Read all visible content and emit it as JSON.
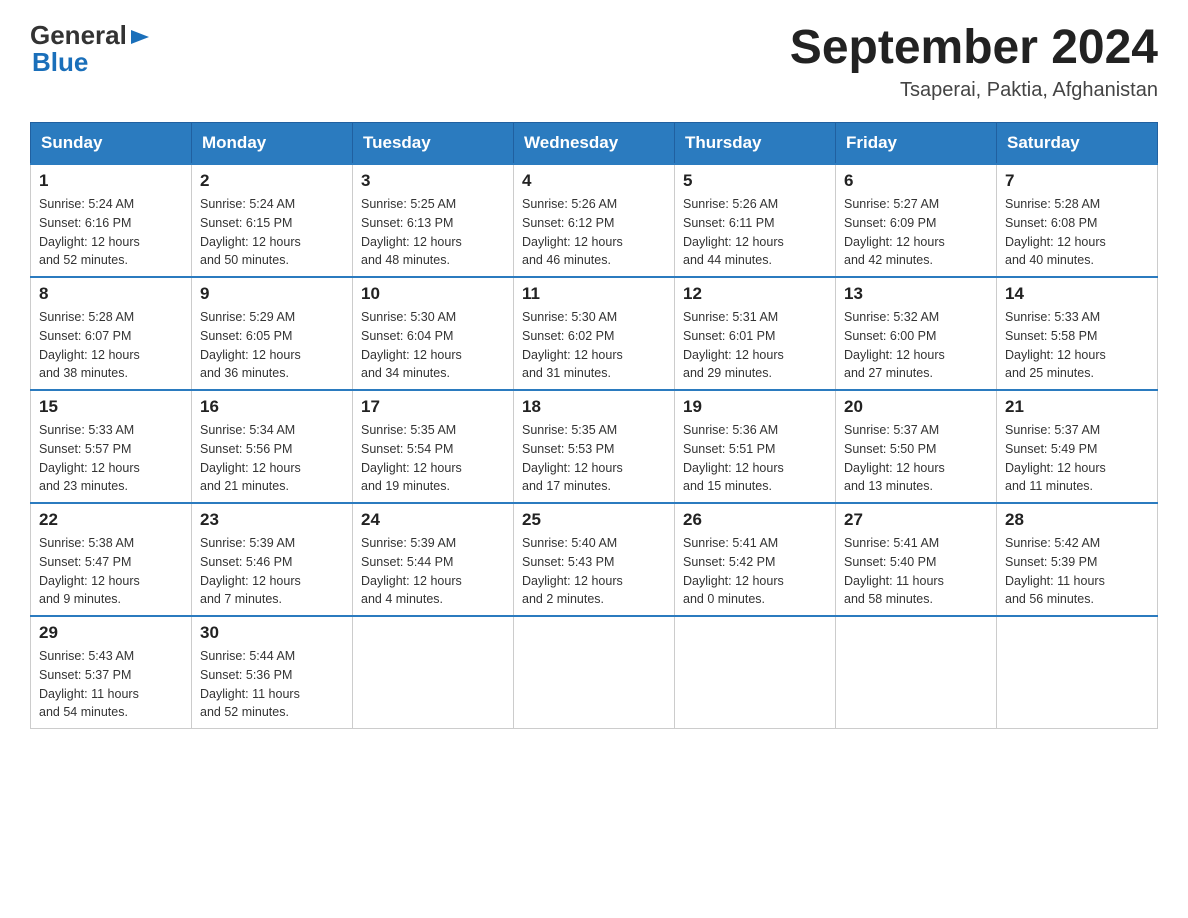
{
  "header": {
    "month_year": "September 2024",
    "location": "Tsaperai, Paktia, Afghanistan",
    "logo_general": "General",
    "logo_blue": "Blue"
  },
  "days_of_week": [
    "Sunday",
    "Monday",
    "Tuesday",
    "Wednesday",
    "Thursday",
    "Friday",
    "Saturday"
  ],
  "weeks": [
    [
      {
        "day": "1",
        "sunrise": "5:24 AM",
        "sunset": "6:16 PM",
        "daylight": "12 hours and 52 minutes."
      },
      {
        "day": "2",
        "sunrise": "5:24 AM",
        "sunset": "6:15 PM",
        "daylight": "12 hours and 50 minutes."
      },
      {
        "day": "3",
        "sunrise": "5:25 AM",
        "sunset": "6:13 PM",
        "daylight": "12 hours and 48 minutes."
      },
      {
        "day": "4",
        "sunrise": "5:26 AM",
        "sunset": "6:12 PM",
        "daylight": "12 hours and 46 minutes."
      },
      {
        "day": "5",
        "sunrise": "5:26 AM",
        "sunset": "6:11 PM",
        "daylight": "12 hours and 44 minutes."
      },
      {
        "day": "6",
        "sunrise": "5:27 AM",
        "sunset": "6:09 PM",
        "daylight": "12 hours and 42 minutes."
      },
      {
        "day": "7",
        "sunrise": "5:28 AM",
        "sunset": "6:08 PM",
        "daylight": "12 hours and 40 minutes."
      }
    ],
    [
      {
        "day": "8",
        "sunrise": "5:28 AM",
        "sunset": "6:07 PM",
        "daylight": "12 hours and 38 minutes."
      },
      {
        "day": "9",
        "sunrise": "5:29 AM",
        "sunset": "6:05 PM",
        "daylight": "12 hours and 36 minutes."
      },
      {
        "day": "10",
        "sunrise": "5:30 AM",
        "sunset": "6:04 PM",
        "daylight": "12 hours and 34 minutes."
      },
      {
        "day": "11",
        "sunrise": "5:30 AM",
        "sunset": "6:02 PM",
        "daylight": "12 hours and 31 minutes."
      },
      {
        "day": "12",
        "sunrise": "5:31 AM",
        "sunset": "6:01 PM",
        "daylight": "12 hours and 29 minutes."
      },
      {
        "day": "13",
        "sunrise": "5:32 AM",
        "sunset": "6:00 PM",
        "daylight": "12 hours and 27 minutes."
      },
      {
        "day": "14",
        "sunrise": "5:33 AM",
        "sunset": "5:58 PM",
        "daylight": "12 hours and 25 minutes."
      }
    ],
    [
      {
        "day": "15",
        "sunrise": "5:33 AM",
        "sunset": "5:57 PM",
        "daylight": "12 hours and 23 minutes."
      },
      {
        "day": "16",
        "sunrise": "5:34 AM",
        "sunset": "5:56 PM",
        "daylight": "12 hours and 21 minutes."
      },
      {
        "day": "17",
        "sunrise": "5:35 AM",
        "sunset": "5:54 PM",
        "daylight": "12 hours and 19 minutes."
      },
      {
        "day": "18",
        "sunrise": "5:35 AM",
        "sunset": "5:53 PM",
        "daylight": "12 hours and 17 minutes."
      },
      {
        "day": "19",
        "sunrise": "5:36 AM",
        "sunset": "5:51 PM",
        "daylight": "12 hours and 15 minutes."
      },
      {
        "day": "20",
        "sunrise": "5:37 AM",
        "sunset": "5:50 PM",
        "daylight": "12 hours and 13 minutes."
      },
      {
        "day": "21",
        "sunrise": "5:37 AM",
        "sunset": "5:49 PM",
        "daylight": "12 hours and 11 minutes."
      }
    ],
    [
      {
        "day": "22",
        "sunrise": "5:38 AM",
        "sunset": "5:47 PM",
        "daylight": "12 hours and 9 minutes."
      },
      {
        "day": "23",
        "sunrise": "5:39 AM",
        "sunset": "5:46 PM",
        "daylight": "12 hours and 7 minutes."
      },
      {
        "day": "24",
        "sunrise": "5:39 AM",
        "sunset": "5:44 PM",
        "daylight": "12 hours and 4 minutes."
      },
      {
        "day": "25",
        "sunrise": "5:40 AM",
        "sunset": "5:43 PM",
        "daylight": "12 hours and 2 minutes."
      },
      {
        "day": "26",
        "sunrise": "5:41 AM",
        "sunset": "5:42 PM",
        "daylight": "12 hours and 0 minutes."
      },
      {
        "day": "27",
        "sunrise": "5:41 AM",
        "sunset": "5:40 PM",
        "daylight": "11 hours and 58 minutes."
      },
      {
        "day": "28",
        "sunrise": "5:42 AM",
        "sunset": "5:39 PM",
        "daylight": "11 hours and 56 minutes."
      }
    ],
    [
      {
        "day": "29",
        "sunrise": "5:43 AM",
        "sunset": "5:37 PM",
        "daylight": "11 hours and 54 minutes."
      },
      {
        "day": "30",
        "sunrise": "5:44 AM",
        "sunset": "5:36 PM",
        "daylight": "11 hours and 52 minutes."
      },
      null,
      null,
      null,
      null,
      null
    ]
  ],
  "labels": {
    "sunrise": "Sunrise:",
    "sunset": "Sunset:",
    "daylight": "Daylight:"
  }
}
